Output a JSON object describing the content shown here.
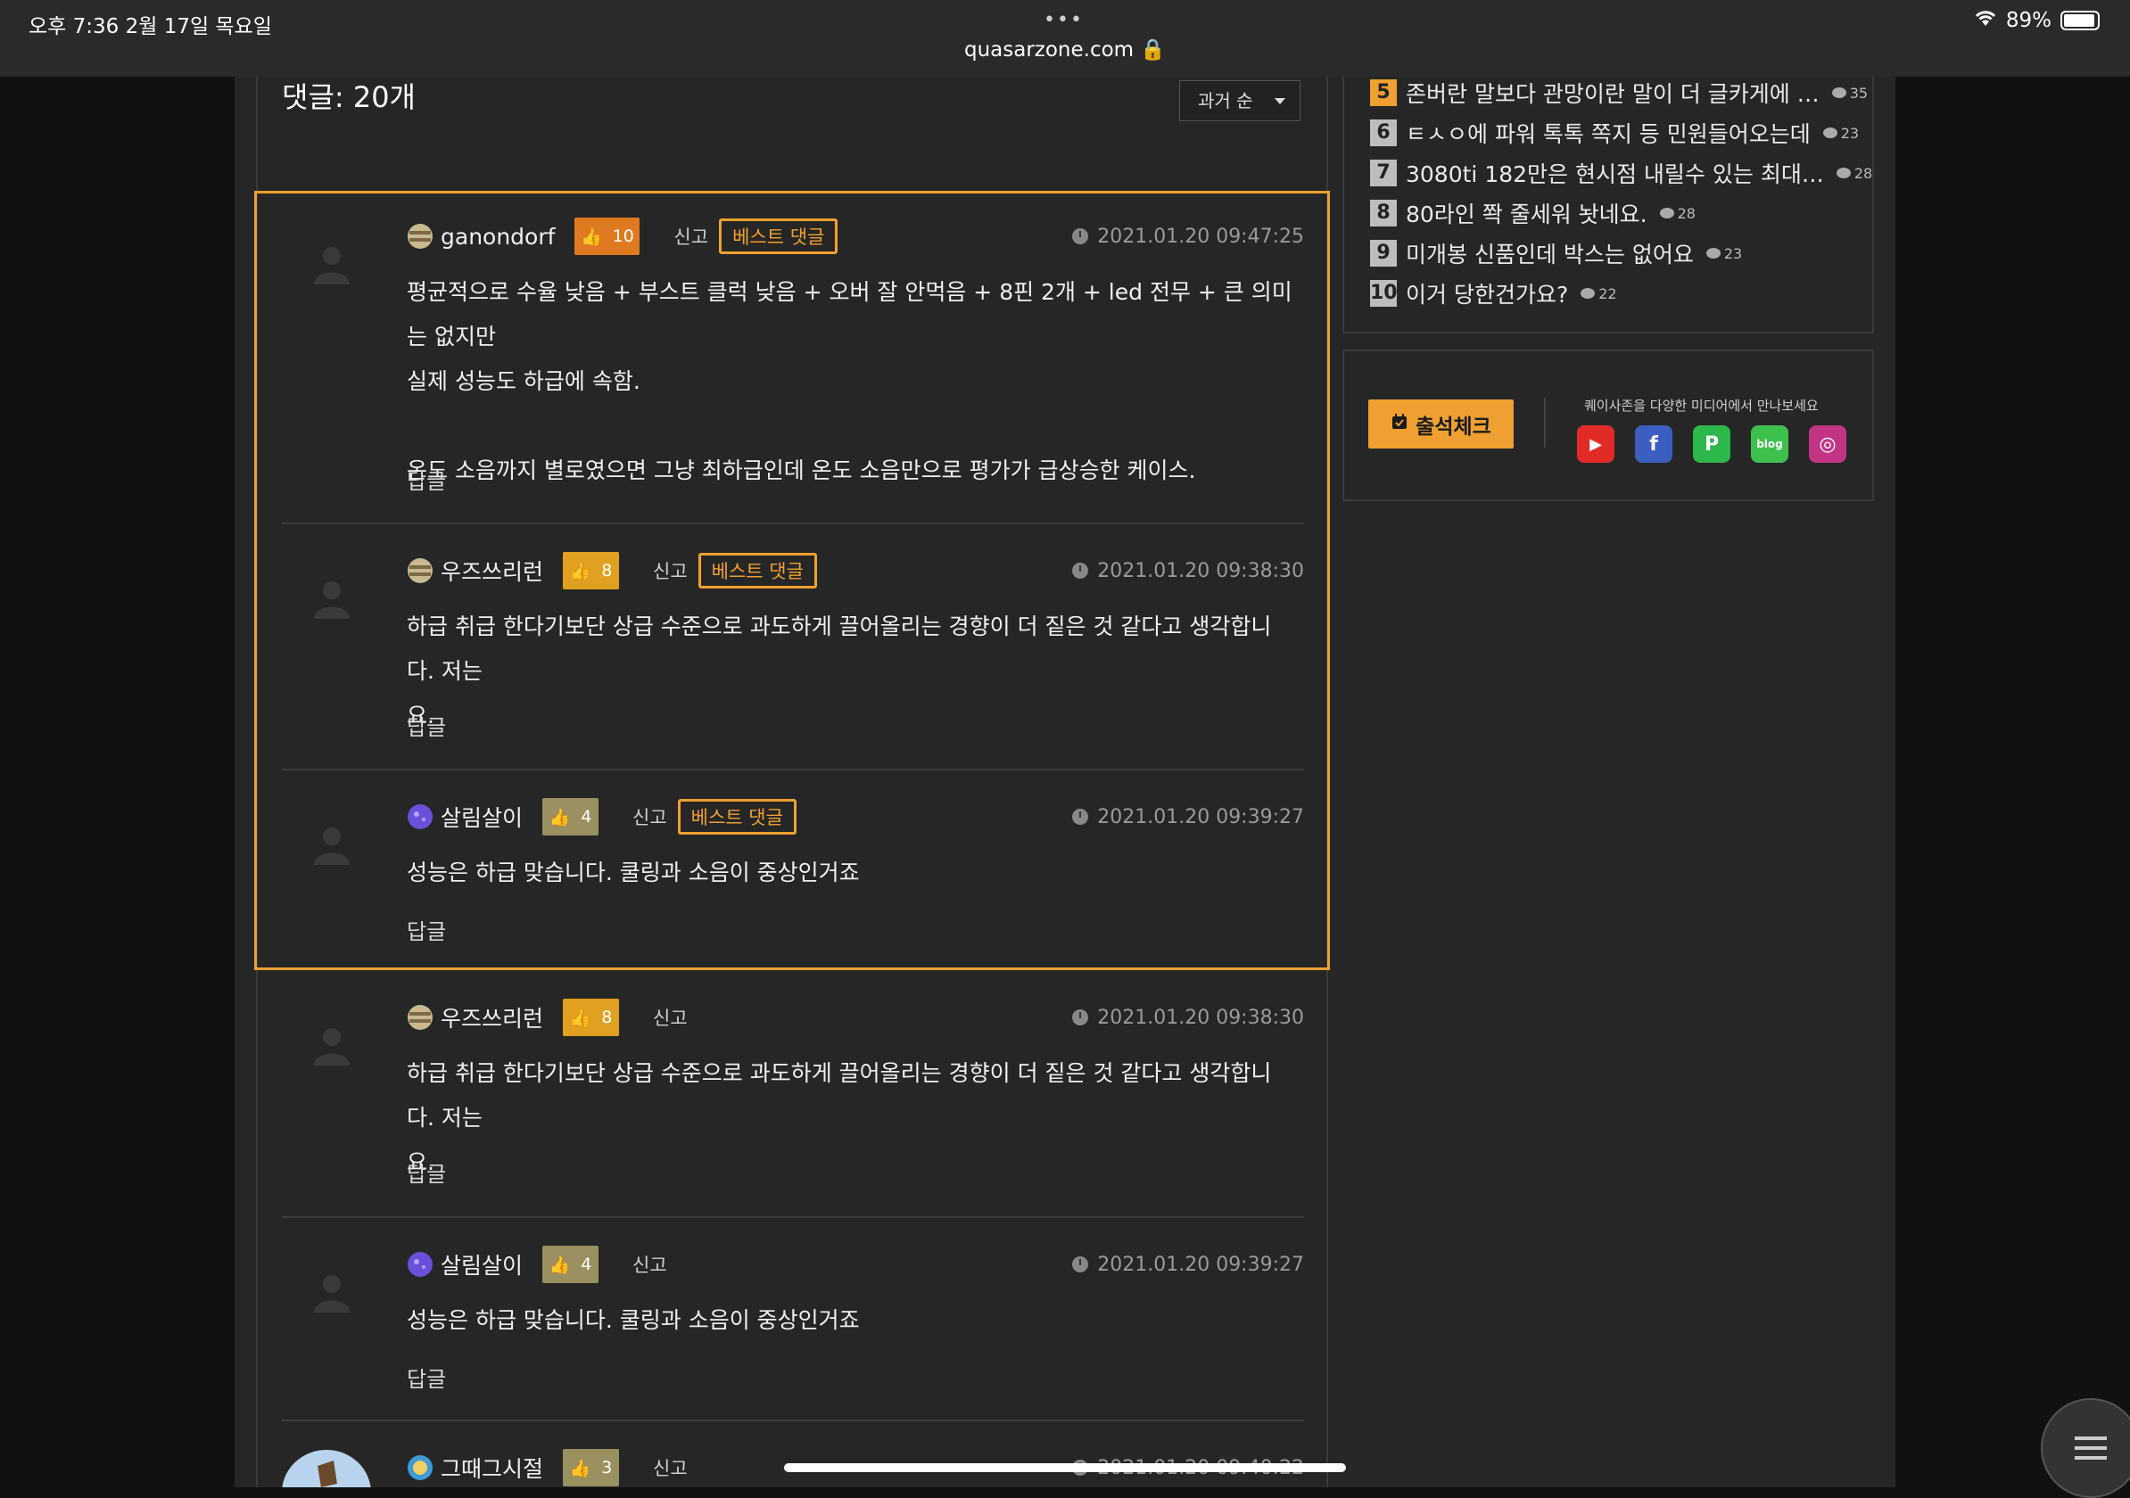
{
  "status_bar": {
    "time_date": "오후 7:36   2월 17일 목요일",
    "dots": "•••",
    "url": "quasarzone.com",
    "battery": "89%"
  },
  "comments_header": {
    "title": "댓글: 20개",
    "sort_label": "과거 순"
  },
  "comments": [
    {
      "user": "ganondorf",
      "likes": "10",
      "report": "신고",
      "best": "베스트 댓글",
      "date": "2021.01.20 09:47:25",
      "body": "평균적으로 수율 낮음 + 부스트 클럭 낮음 + 오버 잘 안먹음 + 8핀 2개  + led 전무 + 큰 의미는 없지만\n실제 성능도 하급에 속함.\n\n온도 소음까지 별로였으면 그냥 최하급인데 온도 소음만으로 평가가 급상승한 케이스.",
      "reply": "답글",
      "like_color": "#e07a20"
    },
    {
      "user": "우즈쓰리런",
      "likes": "8",
      "report": "신고",
      "best": "베스트 댓글",
      "date": "2021.01.20 09:38:30",
      "body": "하급 취급 한다기보단 상급 수준으로 과도하게 끌어올리는 경향이 더 짙은 것 같다고 생각합니다. 저는\n요.",
      "reply": "답글",
      "like_color": "#e0a020"
    },
    {
      "user": "살림살이",
      "likes": "4",
      "report": "신고",
      "best": "베스트 댓글",
      "date": "2021.01.20 09:39:27",
      "body": "성능은 하급 맞습니다.  쿨링과 소음이 중상인거죠",
      "reply": "답글",
      "like_color": "#9a9060"
    },
    {
      "user": "우즈쓰리런",
      "likes": "8",
      "report": "신고",
      "date": "2021.01.20 09:38:30",
      "body": "하급 취급 한다기보단 상급 수준으로 과도하게 끌어올리는 경향이 더 짙은 것 같다고 생각합니다. 저는\n요.",
      "reply": "답글",
      "like_color": "#e0a020"
    },
    {
      "user": "살림살이",
      "likes": "4",
      "report": "신고",
      "date": "2021.01.20 09:39:27",
      "body": "성능은 하급 맞습니다.  쿨링과 소음이 중상인거죠",
      "reply": "답글",
      "like_color": "#9a9060"
    },
    {
      "user": "그때그시절",
      "likes": "3",
      "report": "신고",
      "date": "2021.01.20 09:40:22",
      "like_color": "#9a9060"
    }
  ],
  "rankings": [
    {
      "num": "5",
      "title": "존버란 말보다 관망이란 말이 더 글카게에 …",
      "count": "35"
    },
    {
      "num": "6",
      "title": "ㅌㅅㅇ에 파워 톡톡 쪽지 등 민원들어오는데",
      "count": "23"
    },
    {
      "num": "7",
      "title": "3080ti 182만은 현시점 내릴수 있는 최대…",
      "count": "28"
    },
    {
      "num": "8",
      "title": "80라인 쫙 줄세워 놧네요.",
      "count": "28"
    },
    {
      "num": "9",
      "title": "미개봉 신품인데 박스는 없어요",
      "count": "23"
    },
    {
      "num": "10",
      "title": "이거 당한건가요?",
      "count": "22"
    }
  ],
  "attendance": {
    "button_label": "출석체크",
    "media_text": "퀘이사존을 다양한 미디어에서 만나보세요"
  },
  "sns": [
    {
      "name": "youtube",
      "glyph": "▶",
      "color": "#e22b26"
    },
    {
      "name": "facebook",
      "glyph": "f",
      "color": "#3b5fc0"
    },
    {
      "name": "naver-post",
      "glyph": "P",
      "color": "#2db84b"
    },
    {
      "name": "naver-blog",
      "glyph": "blog",
      "color": "#3ec04d"
    },
    {
      "name": "instagram",
      "glyph": "◎",
      "color": "#c13584"
    }
  ]
}
